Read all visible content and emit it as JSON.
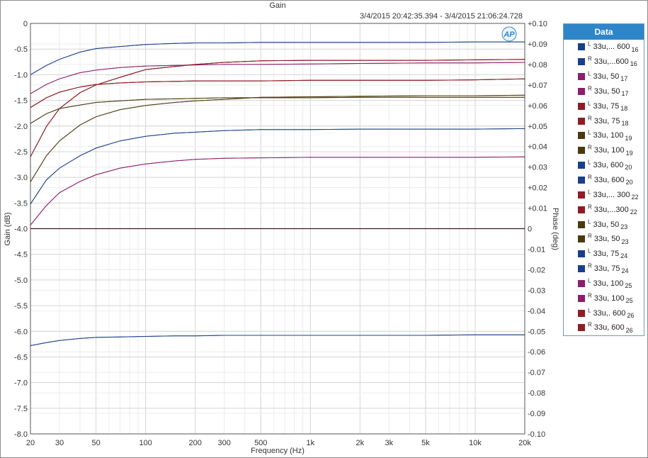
{
  "chart_data": {
    "type": "line",
    "title": "Gain",
    "subtitle": "3/4/2015 20:42:35.394 - 3/4/2015 21:06:24.728",
    "xlabel": "Frequency (Hz)",
    "ylabel": "Gain (dB)",
    "y2label": "Phase (deg)",
    "x_scale": "log",
    "xlim": [
      20,
      20000
    ],
    "ylim": [
      -8,
      0
    ],
    "y2lim": [
      -0.1,
      0.1
    ],
    "grid": true,
    "legend_title": "Data",
    "legend_position": "right",
    "x_ticks": [
      {
        "v": 20,
        "l": "20"
      },
      {
        "v": 30,
        "l": "30"
      },
      {
        "v": 50,
        "l": "50"
      },
      {
        "v": 100,
        "l": "100"
      },
      {
        "v": 200,
        "l": "200"
      },
      {
        "v": 300,
        "l": "300"
      },
      {
        "v": 500,
        "l": "500"
      },
      {
        "v": 1000,
        "l": "1k"
      },
      {
        "v": 2000,
        "l": "2k"
      },
      {
        "v": 3000,
        "l": "3k"
      },
      {
        "v": 5000,
        "l": "5k"
      },
      {
        "v": 10000,
        "l": "10k"
      },
      {
        "v": 20000,
        "l": "20k"
      }
    ],
    "y_ticks": [
      "0",
      "-0.5",
      "-1.0",
      "-1.5",
      "-2.0",
      "-2.5",
      "-3.0",
      "-3.5",
      "-4.0",
      "-4.5",
      "-5.0",
      "-5.5",
      "-6.0",
      "-6.5",
      "-7.0",
      "-7.5",
      "-8.0"
    ],
    "y2_ticks": [
      "+0.10",
      "+0.09",
      "+0.08",
      "+0.07",
      "+0.06",
      "+0.05",
      "+0.04",
      "+0.03",
      "+0.02",
      "+0.01",
      "0",
      "-0.01",
      "-0.02",
      "-0.03",
      "-0.04",
      "-0.05",
      "-0.06",
      "-0.07",
      "-0.08",
      "-0.09",
      "-0.10"
    ],
    "x": [
      20,
      25,
      30,
      40,
      50,
      70,
      100,
      150,
      200,
      300,
      500,
      1000,
      2000,
      5000,
      10000,
      20000
    ],
    "series": [
      {
        "name": "L 33u,... 600 16",
        "color": "#1a3f8a",
        "values": [
          -1.0,
          -0.82,
          -0.7,
          -0.56,
          -0.49,
          -0.45,
          -0.41,
          -0.39,
          -0.38,
          -0.38,
          -0.37,
          -0.37,
          -0.37,
          -0.37,
          -0.36,
          -0.36
        ]
      },
      {
        "name": "R 33u,...600 16",
        "color": "#1a3f8a",
        "values": [
          -6.28,
          -6.22,
          -6.18,
          -6.14,
          -6.12,
          -6.11,
          -6.1,
          -6.09,
          -6.09,
          -6.08,
          -6.08,
          -6.08,
          -6.08,
          -6.08,
          -6.07,
          -6.07
        ]
      },
      {
        "name": "L 33u, 50 17",
        "color": "#8a1f6a",
        "values": [
          -1.37,
          -1.19,
          -1.08,
          -0.96,
          -0.91,
          -0.86,
          -0.83,
          -0.82,
          -0.81,
          -0.8,
          -0.8,
          -0.79,
          -0.78,
          -0.77,
          -0.77,
          -0.76
        ]
      },
      {
        "name": "R 33u, 50 17",
        "color": "#8a1f6a",
        "values": [
          -3.93,
          -3.55,
          -3.3,
          -3.08,
          -2.95,
          -2.82,
          -2.74,
          -2.68,
          -2.65,
          -2.63,
          -2.62,
          -2.61,
          -2.61,
          -2.61,
          -2.61,
          -2.6
        ]
      },
      {
        "name": "L 33u, 75 18",
        "color": "#8f1c24",
        "values": [
          -1.64,
          -1.45,
          -1.34,
          -1.24,
          -1.19,
          -1.16,
          -1.14,
          -1.13,
          -1.12,
          -1.12,
          -1.12,
          -1.11,
          -1.11,
          -1.11,
          -1.1,
          -1.08
        ]
      },
      {
        "name": "R 33u, 75 18",
        "color": "#8f1c24",
        "values": [
          -2.6,
          -2.01,
          -1.66,
          -1.35,
          -1.2,
          -1.05,
          -0.9,
          -0.84,
          -0.8,
          -0.76,
          -0.73,
          -0.72,
          -0.72,
          -0.72,
          -0.71,
          -0.7
        ]
      },
      {
        "name": "L 33u, 100 19",
        "color": "#4a3a10",
        "values": [
          -1.95,
          -1.76,
          -1.66,
          -1.59,
          -1.54,
          -1.51,
          -1.48,
          -1.47,
          -1.46,
          -1.45,
          -1.45,
          -1.45,
          -1.44,
          -1.44,
          -1.44,
          -1.44
        ]
      },
      {
        "name": "R 33u, 100 19",
        "color": "#4a3a10",
        "values": [
          -3.09,
          -2.58,
          -2.29,
          -1.98,
          -1.82,
          -1.68,
          -1.6,
          -1.54,
          -1.51,
          -1.48,
          -1.44,
          -1.43,
          -1.42,
          -1.41,
          -1.41,
          -1.4
        ]
      },
      {
        "name": "L 33u, 600 20",
        "color": "#1a3f8a",
        "values": [
          -3.52,
          -3.05,
          -2.82,
          -2.58,
          -2.43,
          -2.29,
          -2.2,
          -2.14,
          -2.12,
          -2.09,
          -2.07,
          -2.07,
          -2.06,
          -2.06,
          -2.06,
          -2.05
        ]
      },
      {
        "name": "R 33u, 600 20",
        "color": "#1a3f8a",
        "values": [
          -1.0,
          -0.82,
          -0.7,
          -0.56,
          -0.49,
          -0.45,
          -0.41,
          -0.39,
          -0.38,
          -0.38,
          -0.37,
          -0.37,
          -0.37,
          -0.37,
          -0.36,
          -0.36
        ]
      },
      {
        "name": "L 33u,... 300 22",
        "color": "#8f1c24",
        "values": [
          -1.64,
          -1.45,
          -1.34,
          -1.24,
          -1.19,
          -1.16,
          -1.14,
          -1.13,
          -1.12,
          -1.12,
          -1.12,
          -1.11,
          -1.11,
          -1.11,
          -1.1,
          -1.08
        ]
      },
      {
        "name": "R 33u,...300 22",
        "color": "#8f1c24",
        "values": [
          -2.6,
          -2.01,
          -1.66,
          -1.35,
          -1.2,
          -1.05,
          -0.9,
          -0.84,
          -0.8,
          -0.76,
          -0.73,
          -0.72,
          -0.72,
          -0.72,
          -0.71,
          -0.7
        ]
      },
      {
        "name": "L 33u, 50 23",
        "color": "#4a3a10",
        "values": [
          -1.95,
          -1.76,
          -1.66,
          -1.59,
          -1.54,
          -1.51,
          -1.48,
          -1.47,
          -1.46,
          -1.45,
          -1.45,
          -1.45,
          -1.44,
          -1.44,
          -1.44,
          -1.44
        ]
      },
      {
        "name": "R 33u, 50 23",
        "color": "#4a3a10",
        "values": [
          -3.09,
          -2.58,
          -2.29,
          -1.98,
          -1.82,
          -1.68,
          -1.6,
          -1.54,
          -1.51,
          -1.48,
          -1.44,
          -1.43,
          -1.42,
          -1.41,
          -1.41,
          -1.4
        ]
      },
      {
        "name": "L 33u, 75 24",
        "color": "#1a3f8a",
        "values": [
          -3.52,
          -3.05,
          -2.82,
          -2.58,
          -2.43,
          -2.29,
          -2.2,
          -2.14,
          -2.12,
          -2.09,
          -2.07,
          -2.07,
          -2.06,
          -2.06,
          -2.06,
          -2.05
        ]
      },
      {
        "name": "R 33u, 75 24",
        "color": "#1a3f8a",
        "values": [
          -6.28,
          -6.22,
          -6.18,
          -6.14,
          -6.12,
          -6.11,
          -6.1,
          -6.09,
          -6.09,
          -6.08,
          -6.08,
          -6.08,
          -6.08,
          -6.08,
          -6.07,
          -6.07
        ]
      },
      {
        "name": "L 33u, 100 25",
        "color": "#8a1f6a",
        "values": [
          -1.37,
          -1.19,
          -1.08,
          -0.96,
          -0.91,
          -0.86,
          -0.83,
          -0.82,
          -0.81,
          -0.8,
          -0.8,
          -0.79,
          -0.78,
          -0.77,
          -0.77,
          -0.76
        ]
      },
      {
        "name": "R 33u, 100 25",
        "color": "#8a1f6a",
        "values": [
          -3.93,
          -3.55,
          -3.3,
          -3.08,
          -2.95,
          -2.82,
          -2.74,
          -2.68,
          -2.65,
          -2.63,
          -2.62,
          -2.61,
          -2.61,
          -2.61,
          -2.61,
          -2.6
        ]
      },
      {
        "name": "L 33u,. 600 26",
        "color": "#8f1c24",
        "values": [
          -1.64,
          -1.45,
          -1.34,
          -1.24,
          -1.19,
          -1.16,
          -1.14,
          -1.13,
          -1.12,
          -1.12,
          -1.12,
          -1.11,
          -1.11,
          -1.11,
          -1.1,
          -1.08
        ]
      },
      {
        "name": "R 33u, 600 26",
        "color": "#8f1c24",
        "values": [
          -2.6,
          -2.01,
          -1.66,
          -1.35,
          -1.2,
          -1.05,
          -0.9,
          -0.84,
          -0.8,
          -0.76,
          -0.73,
          -0.72,
          -0.72,
          -0.72,
          -0.71,
          -0.7
        ]
      }
    ],
    "phase_series": {
      "name": "Phase",
      "color": "#3a1a2a",
      "values": [
        0,
        0
      ]
    },
    "logo_text": "AP"
  },
  "legend": [
    {
      "side": "L",
      "text": "33u,... 600",
      "num": "16"
    },
    {
      "side": "R",
      "text": "33u,...600",
      "num": "16"
    },
    {
      "side": "L",
      "text": "33u, 50",
      "num": "17"
    },
    {
      "side": "R",
      "text": "33u, 50",
      "num": "17"
    },
    {
      "side": "L",
      "text": "33u, 75",
      "num": "18"
    },
    {
      "side": "R",
      "text": "33u, 75",
      "num": "18"
    },
    {
      "side": "L",
      "text": "33u, 100",
      "num": "19"
    },
    {
      "side": "R",
      "text": "33u, 100",
      "num": "19"
    },
    {
      "side": "L",
      "text": "33u, 600",
      "num": "20"
    },
    {
      "side": "R",
      "text": "33u, 600",
      "num": "20"
    },
    {
      "side": "L",
      "text": "33u,... 300",
      "num": "22"
    },
    {
      "side": "R",
      "text": "33u,...300",
      "num": "22"
    },
    {
      "side": "L",
      "text": "33u, 50",
      "num": "23"
    },
    {
      "side": "R",
      "text": "33u, 50",
      "num": "23"
    },
    {
      "side": "L",
      "text": "33u, 75",
      "num": "24"
    },
    {
      "side": "R",
      "text": "33u, 75",
      "num": "24"
    },
    {
      "side": "L",
      "text": "33u, 100",
      "num": "25"
    },
    {
      "side": "R",
      "text": "33u, 100",
      "num": "25"
    },
    {
      "side": "L",
      "text": "33u,. 600",
      "num": "26"
    },
    {
      "side": "R",
      "text": "33u, 600",
      "num": "26"
    }
  ]
}
